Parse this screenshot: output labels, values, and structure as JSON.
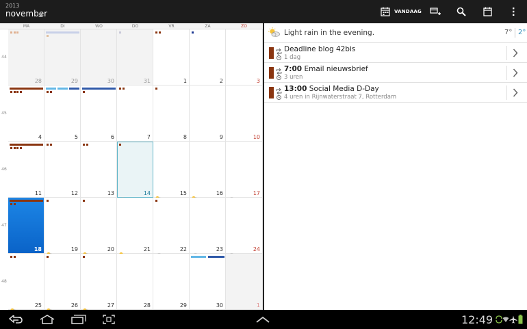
{
  "header": {
    "year": "2013",
    "month": "november",
    "today_label": "VANDAAG",
    "icons": [
      "calendar-today-icon",
      "add-event-icon",
      "search-icon",
      "calendar-view-icon",
      "overflow-menu-icon"
    ]
  },
  "calendar": {
    "weekdays": [
      "MA",
      "DI",
      "WO",
      "DO",
      "VR",
      "ZA",
      "ZO"
    ],
    "weeks": [
      {
        "num": "44",
        "days": [
          {
            "n": "28",
            "other": true,
            "sq": [
              "#e0b090",
              "#e0b090",
              "#e0b090"
            ]
          },
          {
            "n": "29",
            "other": true,
            "bar": [
              {
                "c": "#c8d0e8",
                "s": 0,
                "w": 1
              }
            ],
            "sq": [
              "#e0c0a0"
            ]
          },
          {
            "n": "30",
            "other": true
          },
          {
            "n": "31",
            "other": true,
            "sq": [
              "#c8c8d8"
            ]
          },
          {
            "n": "1",
            "sq": [
              "#8a3510",
              "#8a3510"
            ]
          },
          {
            "n": "2",
            "sq": [
              "#1f3a93"
            ]
          },
          {
            "n": "3",
            "sun": true
          }
        ]
      },
      {
        "num": "45",
        "days": [
          {
            "n": "4",
            "bar": [
              {
                "c": "#8a3510",
                "s": 0,
                "w": 1
              }
            ],
            "sq": [
              "#8a3510",
              "#8a3510",
              "#8a3510",
              "#8a3510"
            ]
          },
          {
            "n": "5",
            "bar": [
              {
                "c": "#63b7e6",
                "s": 0,
                "w": 0.3
              },
              {
                "c": "#63b7e6",
                "s": 0.35,
                "w": 0.3
              },
              {
                "c": "#2f59a8",
                "s": 0.7,
                "w": 0.3
              }
            ],
            "sq": [
              "#8a3510",
              "#8a3510"
            ]
          },
          {
            "n": "6",
            "bar": [
              {
                "c": "#2f59a8",
                "s": 0,
                "w": 1
              }
            ],
            "sq": [
              "#8a3510"
            ]
          },
          {
            "n": "7",
            "sq": [
              "#8a3510",
              "#8a3510"
            ]
          },
          {
            "n": "8",
            "sq": [
              "#8a3510"
            ]
          },
          {
            "n": "9"
          },
          {
            "n": "10",
            "sun": true
          }
        ]
      },
      {
        "num": "46",
        "days": [
          {
            "n": "11",
            "bar": [
              {
                "c": "#8a3510",
                "s": 0,
                "w": 1
              }
            ],
            "sq": [
              "#8a3510",
              "#8a3510",
              "#8a3510",
              "#8a3510"
            ]
          },
          {
            "n": "12",
            "sq": [
              "#8a3510",
              "#8a3510"
            ]
          },
          {
            "n": "13",
            "sq": [
              "#8a3510",
              "#8a3510"
            ]
          },
          {
            "n": "14",
            "today": true,
            "sq": [
              "#8a3510"
            ],
            "w": "cloud"
          },
          {
            "n": "15",
            "w": "sun-cloud"
          },
          {
            "n": "16",
            "w": "sun-cloud"
          },
          {
            "n": "17",
            "sun": true,
            "w": "cloud"
          }
        ]
      },
      {
        "num": "47",
        "days": [
          {
            "n": "18",
            "sel": true,
            "bar": [
              {
                "c": "#8a3510",
                "s": 0,
                "w": 1
              }
            ],
            "sq": [
              "#8a3510",
              "#8a3510"
            ],
            "w": "cloud-white"
          },
          {
            "n": "19",
            "sq": [
              "#8a3510"
            ],
            "w": "sun-cloud"
          },
          {
            "n": "20",
            "sq": [
              "#8a3510"
            ],
            "w": "sun-cloud"
          },
          {
            "n": "21",
            "w": "sun"
          },
          {
            "n": "22",
            "sq": [
              "#8a3510"
            ],
            "w": "cloud"
          },
          {
            "n": "23",
            "w": "cloud"
          },
          {
            "n": "24",
            "sun": true,
            "w": "cloud"
          }
        ]
      },
      {
        "num": "48",
        "days": [
          {
            "n": "25",
            "sq": [
              "#8a3510",
              "#8a3510"
            ],
            "w": "sun-cloud"
          },
          {
            "n": "26",
            "sq": [
              "#8a3510"
            ],
            "w": "sun-cloud"
          },
          {
            "n": "27",
            "sq": [
              "#8a3510"
            ],
            "w": "sun-cloud"
          },
          {
            "n": "28"
          },
          {
            "n": "29"
          },
          {
            "n": "30",
            "bar": [
              {
                "c": "#63b7e6",
                "s": 0,
                "w": 0.45
              },
              {
                "c": "#2f59a8",
                "s": 0.5,
                "w": 0.5
              }
            ]
          },
          {
            "n": "1",
            "sun": true,
            "other": true
          }
        ]
      }
    ]
  },
  "agenda": {
    "weather_text": "Light rain in the evening.",
    "temp_high": "7°",
    "temp_low": "2°",
    "events": [
      {
        "time": "",
        "title": "Deadline blog 42bis",
        "sub": "1 dag"
      },
      {
        "time": "7:00",
        "title": " Email nieuwsbrief",
        "sub": "3 uren"
      },
      {
        "time": "13:00",
        "title": " Social Media D-Day",
        "sub": "4 uren in Rijnwaterstraat 7, Rotterdam"
      }
    ]
  },
  "sysbar": {
    "clock": "12:49",
    "icons": [
      "back-icon",
      "home-icon",
      "recent-apps-icon",
      "screenshot-icon",
      "chevron-up-icon",
      "sync-icon",
      "wifi-icon",
      "airplane-icon",
      "battery-icon"
    ]
  }
}
